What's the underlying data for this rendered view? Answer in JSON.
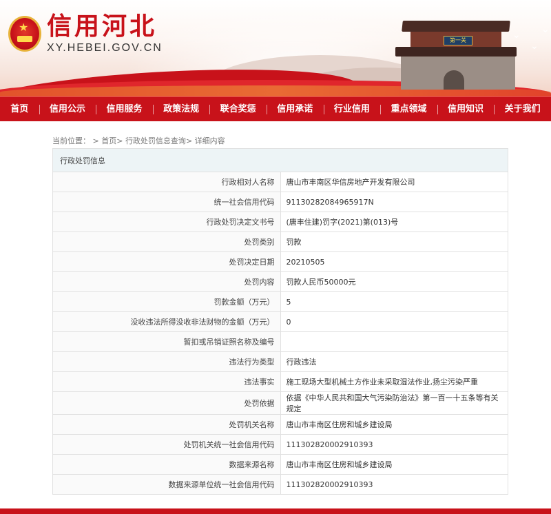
{
  "site": {
    "name_cn": "信用河北",
    "name_en": "XY.HEBEI.GOV.CN",
    "tower_plaque": "第一关",
    "accent_color": "#c8121a"
  },
  "nav": {
    "items": [
      "首页",
      "信用公示",
      "信用服务",
      "政策法规",
      "联合奖惩",
      "信用承诺",
      "行业信用",
      "重点领域",
      "信用知识",
      "关于我们"
    ]
  },
  "breadcrumb": {
    "prefix": "当前位置：",
    "sep": ">",
    "items": [
      "首页",
      "行政处罚信息查询",
      "详细内容"
    ]
  },
  "panel": {
    "title": "行政处罚信息",
    "rows": [
      {
        "label": "行政相对人名称",
        "value": "唐山市丰南区华信房地产开发有限公司"
      },
      {
        "label": "统一社会信用代码",
        "value": "91130282084965917N"
      },
      {
        "label": "行政处罚决定文书号",
        "value": "(唐丰住建)罚字(2021)第(013)号"
      },
      {
        "label": "处罚类别",
        "value": "罚款"
      },
      {
        "label": "处罚决定日期",
        "value": "20210505"
      },
      {
        "label": "处罚内容",
        "value": "罚款人民币50000元"
      },
      {
        "label": "罚款金额（万元）",
        "value": "5"
      },
      {
        "label": "没收违法所得没收非法财物的金额（万元）",
        "value": "0"
      },
      {
        "label": "暂扣或吊销证照名称及编号",
        "value": ""
      },
      {
        "label": "违法行为类型",
        "value": "行政违法"
      },
      {
        "label": "违法事实",
        "value": "施工现场大型机械土方作业未采取湿法作业,扬尘污染严重"
      },
      {
        "label": "处罚依据",
        "value": "依据《中华人民共和国大气污染防治法》第一百一十五条等有关规定"
      },
      {
        "label": "处罚机关名称",
        "value": "唐山市丰南区住房和城乡建设局"
      },
      {
        "label": "处罚机关统一社会信用代码",
        "value": "111302820002910393"
      },
      {
        "label": "数据来源名称",
        "value": "唐山市丰南区住房和城乡建设局"
      },
      {
        "label": "数据来源单位统一社会信用代码",
        "value": "111302820002910393"
      }
    ]
  }
}
